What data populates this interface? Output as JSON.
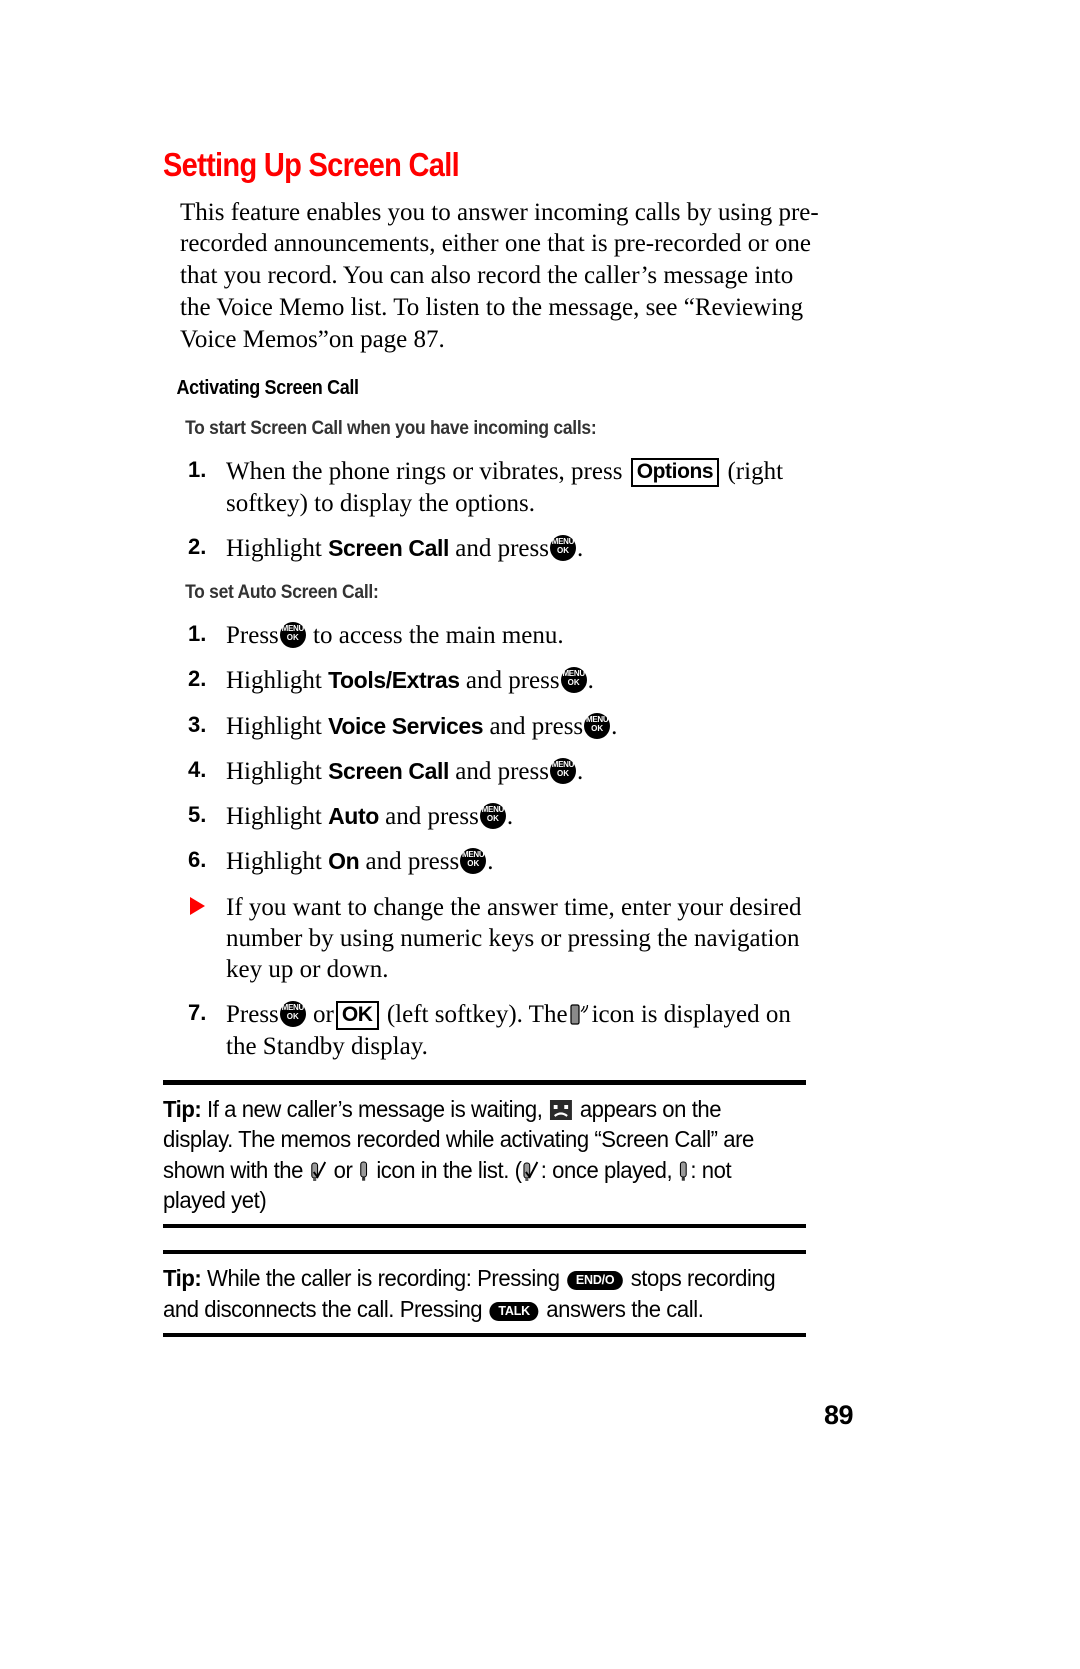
{
  "page": {
    "number": "89"
  },
  "title": "Setting Up Screen Call",
  "intro": "This feature enables you to answer incoming calls by using pre-recorded announcements, either one that is pre-recorded or one that you record. You can also record the caller’s message into the Voice Memo list. To listen to the message, see “Reviewing Voice Memos”on page 87.",
  "section": {
    "heading": "Activating Screen Call"
  },
  "subsection_1": {
    "heading": "To start Screen Call when you have incoming calls:",
    "steps": [
      {
        "num": "1.",
        "text_before": "When the phone rings or vibrates, press",
        "key": "Options",
        "text_after": "(right softkey) to display the options."
      },
      {
        "num": "2.",
        "text_before": "Highlight",
        "bold": "Screen Call",
        "text_mid": "and press",
        "key_menu": {
          "line1": "MENU",
          "line2": "OK"
        },
        "text_after": "."
      }
    ]
  },
  "subsection_2": {
    "heading": "To set Auto Screen Call:",
    "steps": [
      {
        "num": "1.",
        "text_before": "Press",
        "key_menu": {
          "line1": "MENU",
          "line2": "OK"
        },
        "text_after": "to access the main menu."
      },
      {
        "num": "2.",
        "text_before": "Highlight",
        "bold": "Tools/Extras",
        "text_mid": "and press",
        "key_menu": {
          "line1": "MENU",
          "line2": "OK"
        },
        "text_after": "."
      },
      {
        "num": "3.",
        "text_before": "Highlight",
        "bold": "Voice Services",
        "text_mid": "and press",
        "key_menu": {
          "line1": "MENU",
          "line2": "OK"
        },
        "text_after": "."
      },
      {
        "num": "4.",
        "text_before": "Highlight",
        "bold": "Screen Call",
        "text_mid": "and press",
        "key_menu": {
          "line1": "MENU",
          "line2": "OK"
        },
        "text_after": "."
      },
      {
        "num": "5.",
        "text_before": "Highlight",
        "bold": "Auto",
        "text_mid": "and press",
        "key_menu": {
          "line1": "MENU",
          "line2": "OK"
        },
        "text_after": "."
      },
      {
        "num": "6.",
        "text_before": "Highlight",
        "bold": "On",
        "text_mid": "and press",
        "key_menu": {
          "line1": "MENU",
          "line2": "OK"
        },
        "text_after": "."
      }
    ],
    "note": {
      "bullet": "triangle-bullet-icon",
      "text": "If you want to change the answer time, enter your desired number by using numeric keys or pressing the navigation key up or down."
    },
    "final_step": {
      "num": "7.",
      "text_before": "Press",
      "key_menu": {
        "line1": "MENU",
        "line2": "OK"
      },
      "text_mid_1": "or",
      "key_ok": "OK",
      "text_mid_2": "(left softkey). The",
      "icon": "screen-call-icon",
      "text_after": "icon is displayed on the Standby display."
    }
  },
  "tips": [
    {
      "label": "Tip:",
      "part_1": "If a new caller’s message is waiting,",
      "icon_1": "sad-face-icon",
      "part_2": "appears on the display. The memos recorded while activating “Screen Call” are shown with the",
      "icon_2": "memo-played-icon",
      "part_3": "or",
      "icon_3": "memo-unplayed-icon",
      "part_4": "icon in the list. (",
      "icon_4": "memo-played-icon",
      "part_5": ": once played,",
      "icon_5": "memo-unplayed-icon",
      "part_6": ": not played yet)"
    },
    {
      "label": "Tip:",
      "part_1": "While the caller is recording: Pressing",
      "key_1": "END/O",
      "part_2": "stops recording and disconnects the call. Pressing",
      "key_2": "TALK",
      "part_3": "answers the call."
    }
  ],
  "colors": {
    "heading_red": "#ff0000",
    "bullet_red": "#ff0000",
    "text_black": "#000000",
    "subheading_gray": "#333333"
  }
}
